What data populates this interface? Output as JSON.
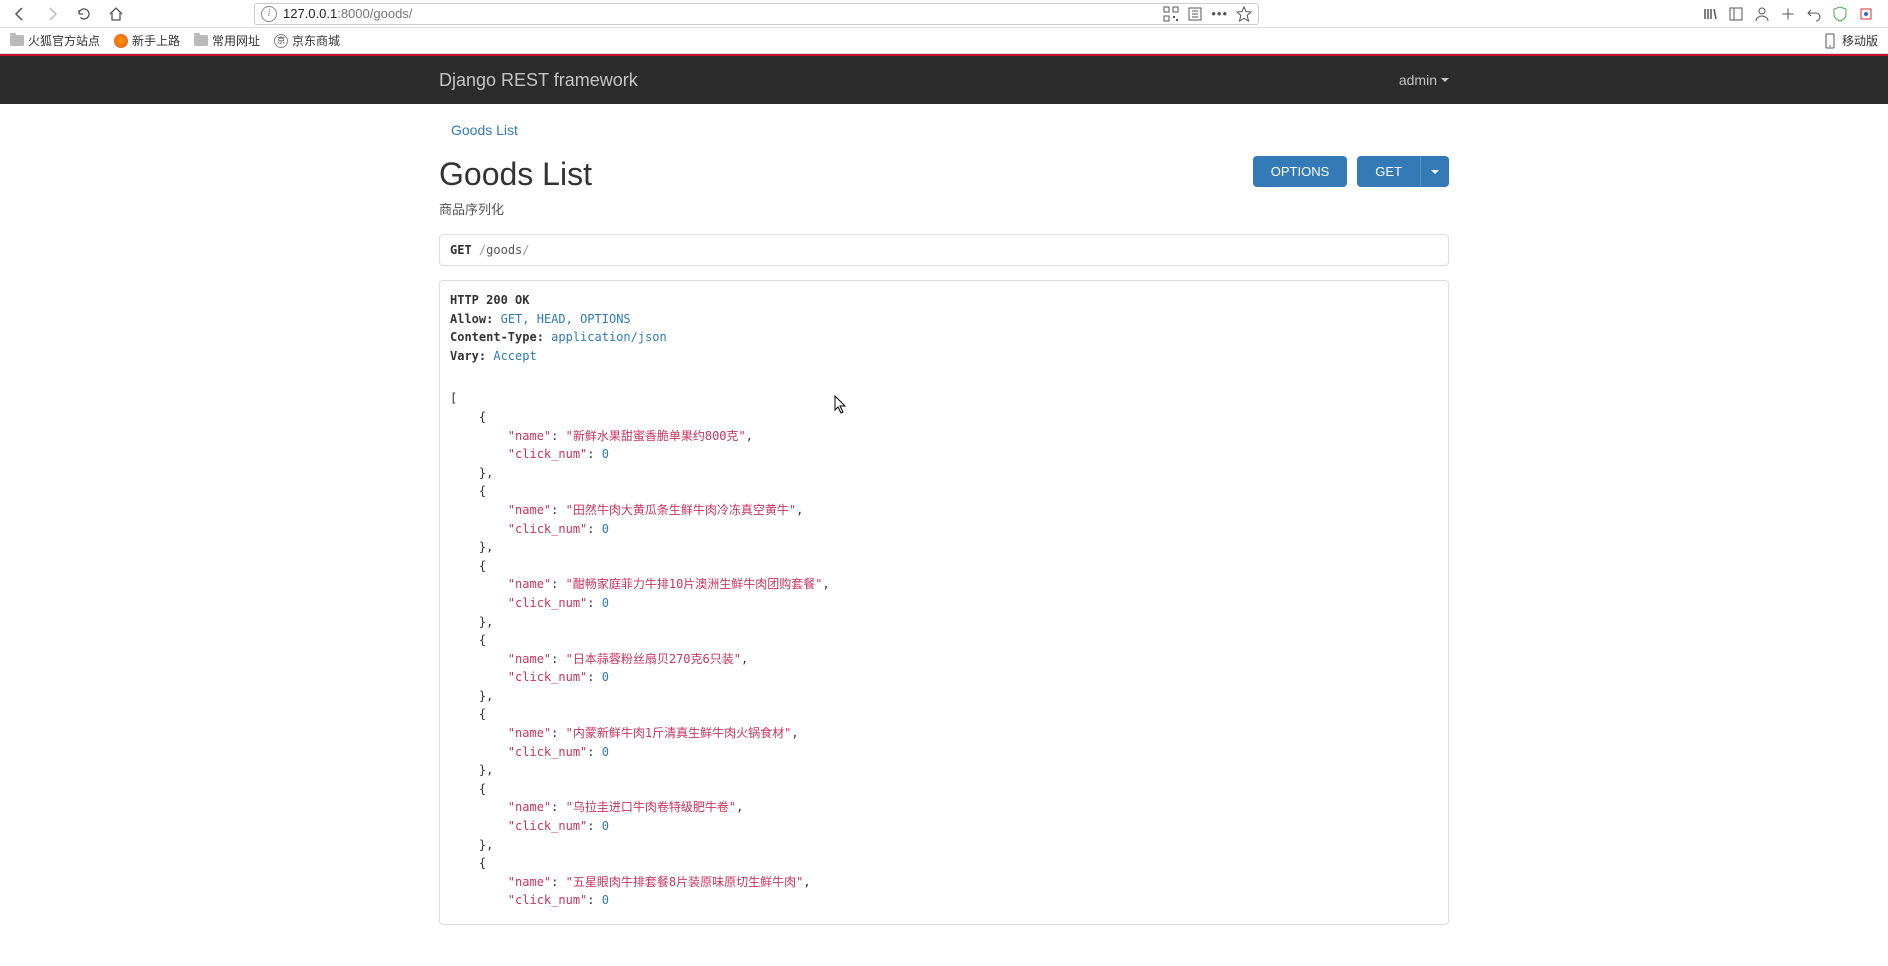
{
  "browser": {
    "url_host": "127.0.0.1",
    "url_port": ":8000",
    "url_path": "/goods/",
    "mobile_label": "移动版"
  },
  "bookmarks": {
    "firefox_official": "火狐官方站点",
    "newbie": "新手上路",
    "common_sites": "常用网址",
    "jd": "京东商城"
  },
  "header": {
    "brand": "Django REST framework",
    "user": "admin"
  },
  "breadcrumb": "Goods List",
  "page": {
    "title": "Goods List",
    "subtitle": "商品序列化",
    "options_btn": "OPTIONS",
    "get_btn": "GET"
  },
  "request": {
    "method": "GET",
    "path": "goods"
  },
  "response": {
    "status": "HTTP 200 OK",
    "headers": [
      {
        "name": "Allow",
        "value": "GET, HEAD, OPTIONS"
      },
      {
        "name": "Content-Type",
        "value": "application/json"
      },
      {
        "name": "Vary",
        "value": "Accept"
      }
    ],
    "items": [
      {
        "name": "新鲜水果甜蜜香脆单果约800克",
        "click_num": 0
      },
      {
        "name": "田然牛肉大黄瓜条生鲜牛肉冷冻真空黄牛",
        "click_num": 0
      },
      {
        "name": "酣畅家庭菲力牛排10片澳洲生鲜牛肉团购套餐",
        "click_num": 0
      },
      {
        "name": "日本蒜蓉粉丝扇贝270克6只装",
        "click_num": 0
      },
      {
        "name": "内蒙新鲜牛肉1斤清真生鲜牛肉火锅食材",
        "click_num": 0
      },
      {
        "name": "乌拉圭进口牛肉卷特级肥牛卷",
        "click_num": 0
      },
      {
        "name": "五星眼肉牛排套餐8片装原味原切生鲜牛肉",
        "click_num": 0,
        "truncated": true
      }
    ]
  }
}
